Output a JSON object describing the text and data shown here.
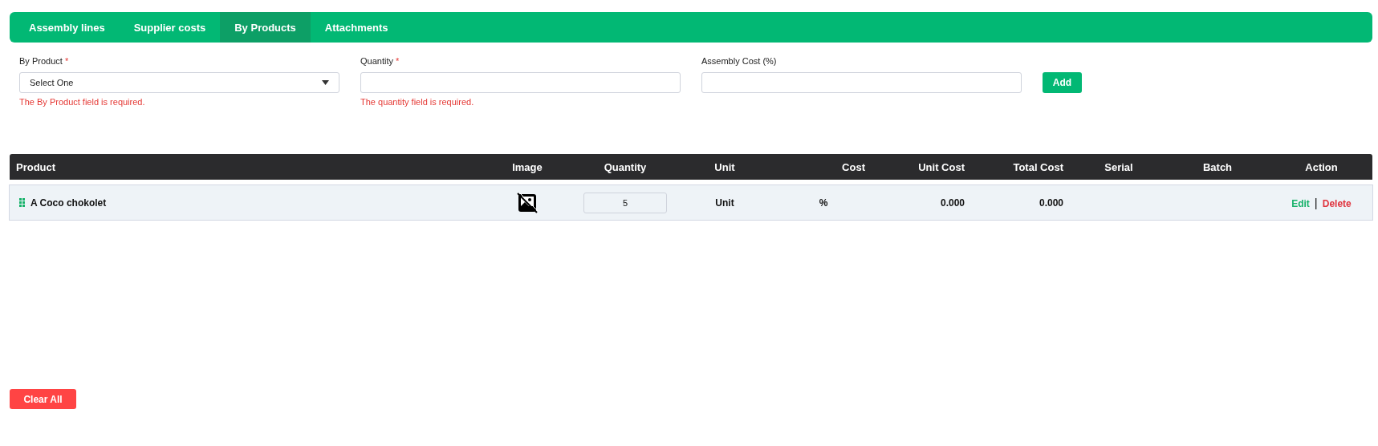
{
  "tabs": [
    {
      "label": "Assembly lines",
      "selected": false
    },
    {
      "label": "Supplier costs",
      "selected": false
    },
    {
      "label": "By Products",
      "selected": true
    },
    {
      "label": "Attachments",
      "selected": false
    }
  ],
  "form": {
    "fields": [
      {
        "kind": "select",
        "label": "By Product",
        "required_mark": "*",
        "value": "Select One",
        "error": "The By Product field is required."
      },
      {
        "kind": "text",
        "label": "Quantity",
        "required_mark": "*",
        "error": "The quantity field is required."
      },
      {
        "kind": "text",
        "label": "Assembly Cost (%)"
      }
    ],
    "add_button": "Add"
  },
  "table": {
    "columns": [
      "Product",
      "Image",
      "Quantity",
      "Unit",
      "Cost",
      "Unit Cost",
      "Total Cost",
      "Serial",
      "Batch",
      "Action"
    ],
    "rows": [
      {
        "product": "A Coco chokolet",
        "quantity": "5",
        "unit": "Unit",
        "cost": "%",
        "unit_cost": "0.000",
        "total_cost": "0.000",
        "edit": "Edit",
        "separator": "|",
        "delete": "Delete"
      }
    ]
  },
  "clear_button": "Clear All"
}
